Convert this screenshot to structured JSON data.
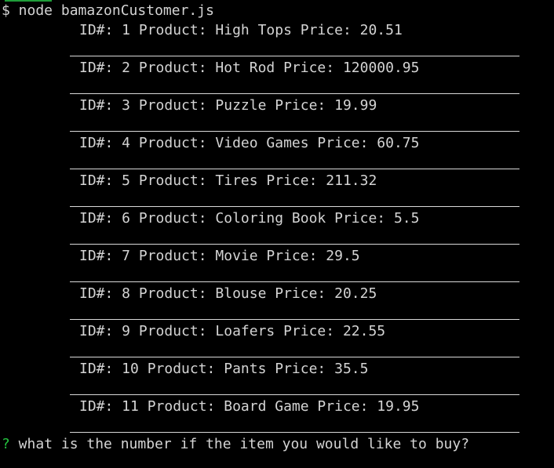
{
  "terminal": {
    "command": "$ node bamazonCustomer.js",
    "products": [
      {
        "text": "ID#: 1 Product: High Tops Price: 20.51"
      },
      {
        "text": "ID#: 2 Product: Hot Rod Price: 120000.95"
      },
      {
        "text": "ID#: 3 Product: Puzzle Price: 19.99"
      },
      {
        "text": "ID#: 4 Product: Video Games Price: 60.75"
      },
      {
        "text": "ID#: 5 Product: Tires Price: 211.32"
      },
      {
        "text": "ID#: 6 Product: Coloring Book Price: 5.5"
      },
      {
        "text": "ID#: 7 Product: Movie Price: 29.5"
      },
      {
        "text": "ID#: 8 Product: Blouse Price: 20.25"
      },
      {
        "text": "ID#: 9 Product: Loafers Price: 22.55"
      },
      {
        "text": "ID#: 10 Product: Pants Price: 35.5"
      },
      {
        "text": "ID#: 11 Product: Board Game Price: 19.95"
      }
    ],
    "prompt": {
      "marker": "?",
      "question": " what is the number if the item you would like to buy?"
    }
  },
  "colors": {
    "background": "#000000",
    "text": "#d4d4d4",
    "rule": "#d9d9d9",
    "prompt_marker": "#23c53f"
  }
}
